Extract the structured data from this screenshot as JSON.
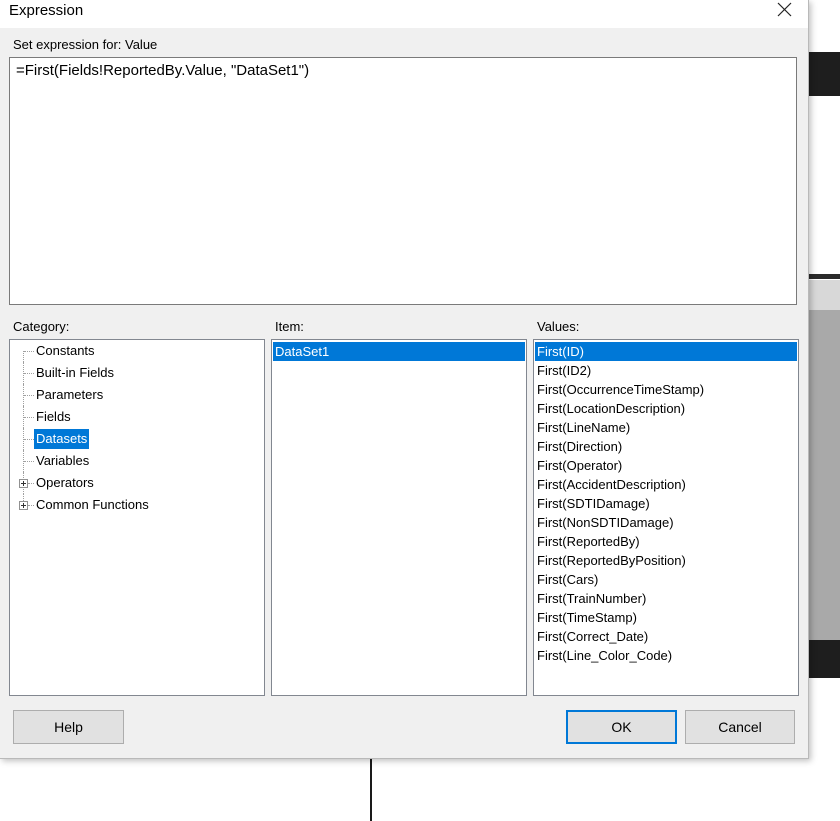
{
  "window": {
    "title": "Expression"
  },
  "expression": {
    "label": "Set expression for: Value",
    "value": "=First(Fields!ReportedBy.Value, \"DataSet1\")"
  },
  "category": {
    "label": "Category:",
    "items": [
      {
        "label": "Constants",
        "expandable": false
      },
      {
        "label": "Built-in Fields",
        "expandable": false
      },
      {
        "label": "Parameters",
        "expandable": false
      },
      {
        "label": "Fields",
        "expandable": false
      },
      {
        "label": "Datasets",
        "expandable": false,
        "selected": true
      },
      {
        "label": "Variables",
        "expandable": false
      },
      {
        "label": "Operators",
        "expandable": true
      },
      {
        "label": "Common Functions",
        "expandable": true
      }
    ]
  },
  "item": {
    "label": "Item:",
    "items": [
      {
        "label": "DataSet1",
        "selected": true
      }
    ]
  },
  "values": {
    "label": "Values:",
    "items": [
      {
        "label": "First(ID)",
        "selected": true
      },
      {
        "label": "First(ID2)"
      },
      {
        "label": "First(OccurrenceTimeStamp)"
      },
      {
        "label": "First(LocationDescription)"
      },
      {
        "label": "First(LineName)"
      },
      {
        "label": "First(Direction)"
      },
      {
        "label": "First(Operator)"
      },
      {
        "label": "First(AccidentDescription)"
      },
      {
        "label": "First(SDTIDamage)"
      },
      {
        "label": "First(NonSDTIDamage)"
      },
      {
        "label": "First(ReportedBy)"
      },
      {
        "label": "First(ReportedByPosition)"
      },
      {
        "label": "First(Cars)"
      },
      {
        "label": "First(TrainNumber)"
      },
      {
        "label": "First(TimeStamp)"
      },
      {
        "label": "First(Correct_Date)"
      },
      {
        "label": "First(Line_Color_Code)"
      }
    ]
  },
  "buttons": {
    "help": "Help",
    "ok": "OK",
    "cancel": "Cancel"
  },
  "colors": {
    "selection": "#0078d7",
    "dialog_bg": "#f0f0f0"
  }
}
